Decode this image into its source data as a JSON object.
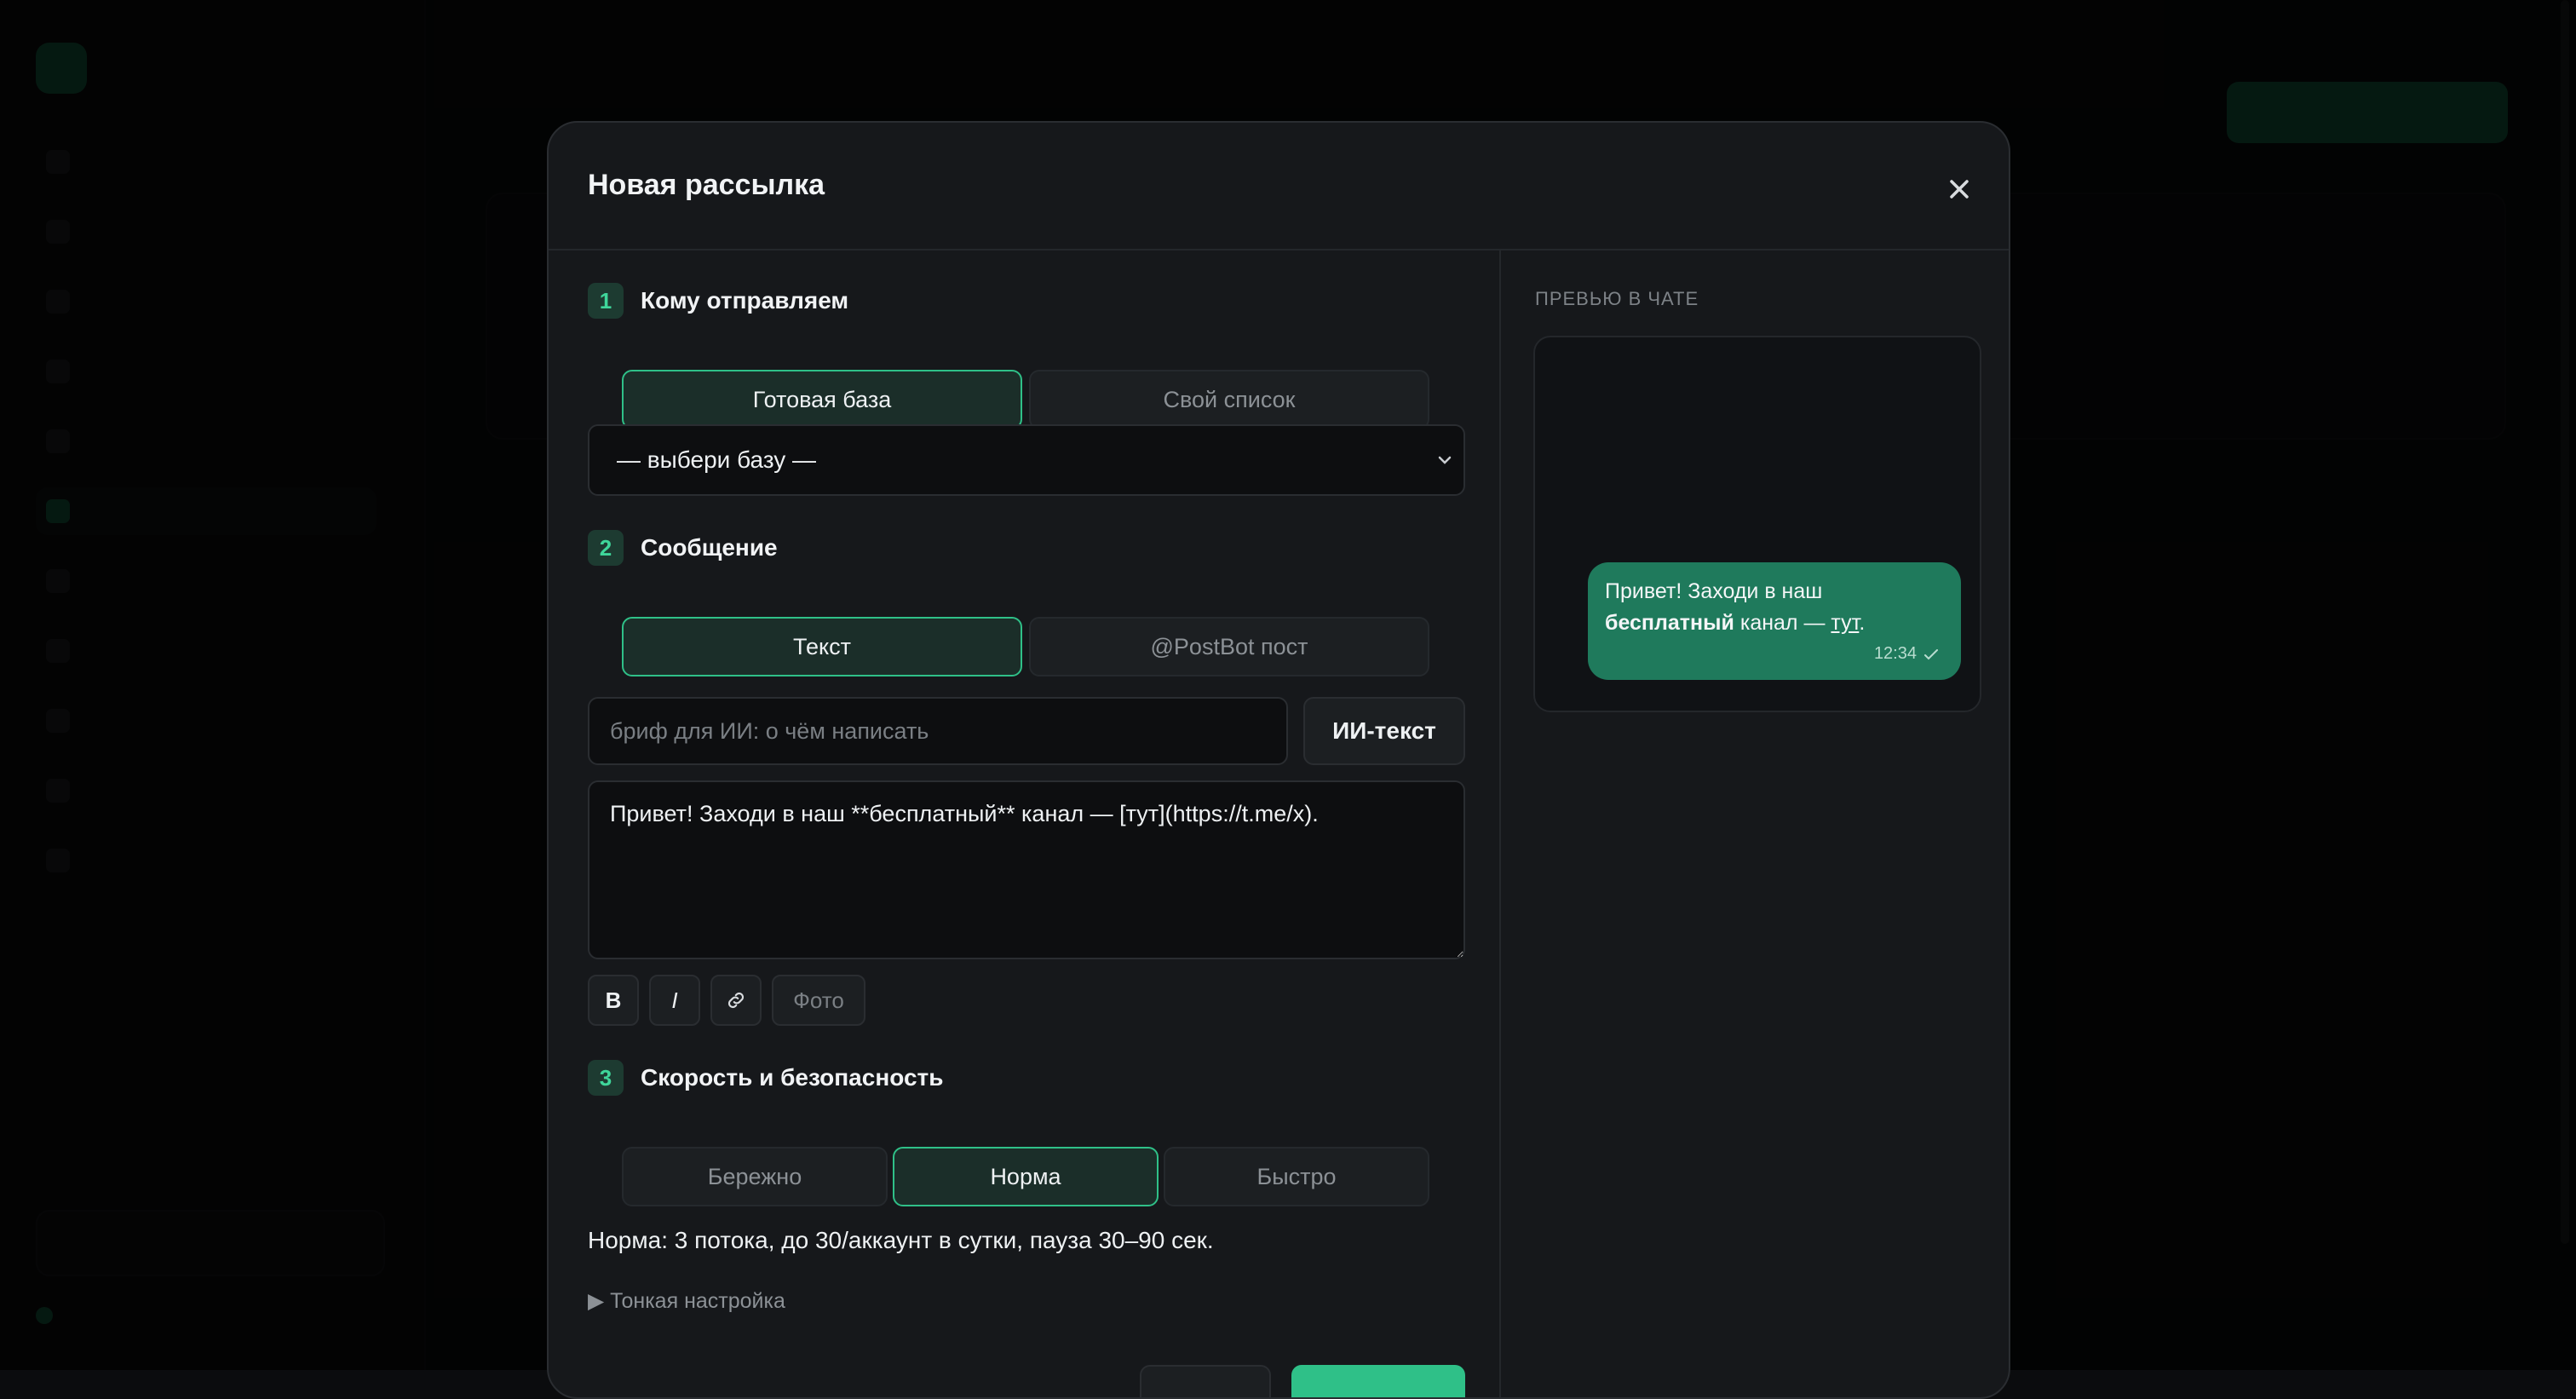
{
  "modal": {
    "title": "Новая рассылка",
    "close_label": "×"
  },
  "step1": {
    "num": "1",
    "title": "Кому отправляем",
    "tabs": [
      "Готовая база",
      "Свой список"
    ],
    "active_tab": 0,
    "select_value": "— выбери базу —"
  },
  "step2": {
    "num": "2",
    "title": "Сообщение",
    "tabs": [
      "Текст",
      "@PostBot пост"
    ],
    "active_tab": 0,
    "brief_placeholder": "бриф для ИИ: о чём написать",
    "ai_button": "ИИ-текст",
    "message_value": "Привет! Заходи в наш **бесплатный** канал — [тут](https://t.me/x).",
    "toolbar": {
      "bold": "B",
      "italic": "I",
      "photo": "Фото"
    }
  },
  "step3": {
    "num": "3",
    "title": "Скорость и безопасность",
    "tabs": [
      "Бережно",
      "Норма",
      "Быстро"
    ],
    "active_tab": 1,
    "description": "Норма: 3 потока, до 30/аккаунт в сутки, пауза 30–90 сек.",
    "fine_tune": "▶ Тонкая настройка"
  },
  "preview": {
    "label": "ПРЕВЬЮ В ЧАТЕ",
    "msg_part1": "Привет! Заходи в наш",
    "msg_bold": "бесплатный",
    "msg_part2": "канал —",
    "msg_link": "тут",
    "msg_end": ".",
    "time": "12:34"
  },
  "colors": {
    "accent": "#2fc088",
    "bubble": "#1f7a5c"
  }
}
